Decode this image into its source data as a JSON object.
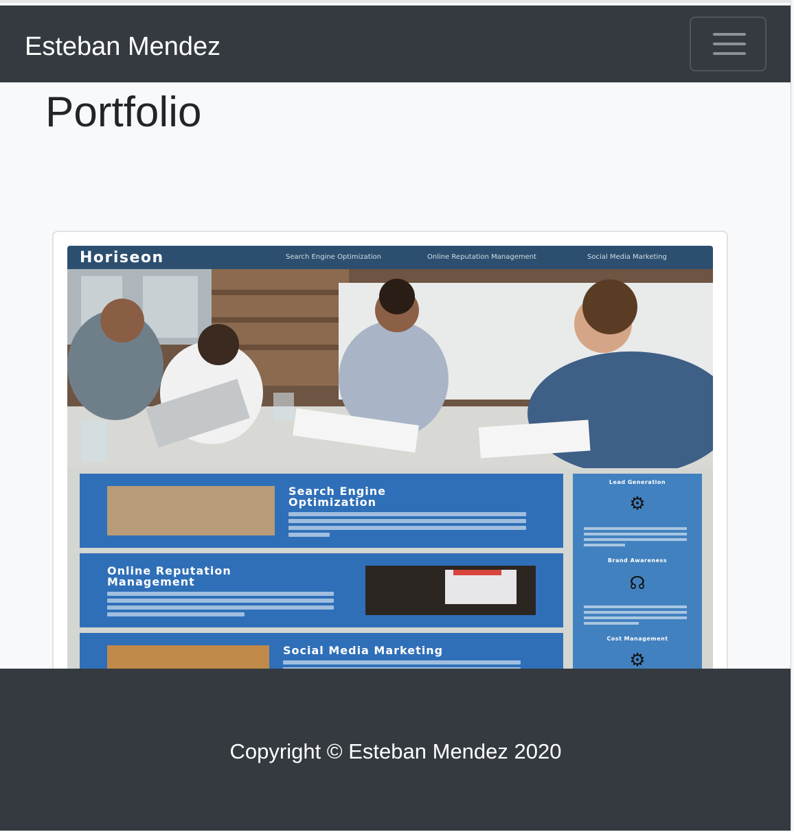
{
  "navbar": {
    "brand": "Esteban Mendez",
    "toggle_icon": "hamburger-menu-icon"
  },
  "page": {
    "title": "Portfolio"
  },
  "portfolio_item": {
    "site_logo": "Horiseon",
    "site_nav": [
      "Search Engine Optimization",
      "Online Reputation Management",
      "Social Media Marketing"
    ],
    "sections": [
      {
        "title": "Search Engine Optimization"
      },
      {
        "title": "Online Reputation Management"
      },
      {
        "title": "Social Media Marketing"
      }
    ],
    "sidebar": [
      {
        "title": "Lead Generation",
        "icon": "lead-generation-icon"
      },
      {
        "title": "Brand Awareness",
        "icon": "brand-awareness-icon"
      },
      {
        "title": "Cost Management",
        "icon": "cost-management-icon"
      }
    ]
  },
  "footer": {
    "copyright": "Copyright © Esteban Mendez 2020"
  },
  "colors": {
    "navbar_bg": "#343a40",
    "page_bg": "#f8f9fa",
    "horiseon_header": "#2c4f6f",
    "horiseon_section": "#2f6fb8",
    "horiseon_sidebar": "#4281bf"
  }
}
